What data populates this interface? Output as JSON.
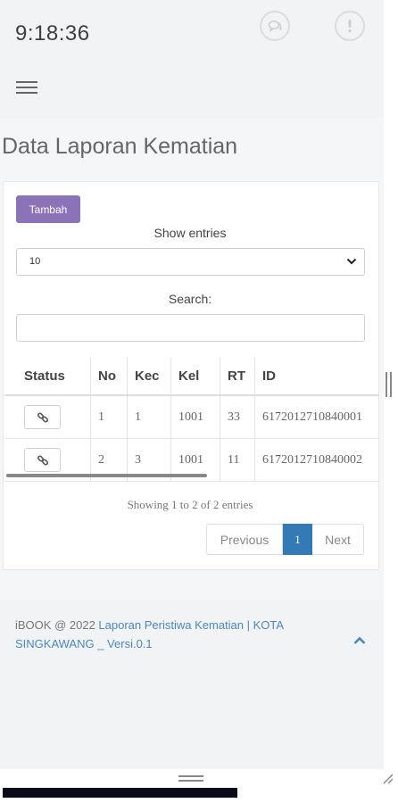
{
  "header": {
    "time": "9:18:36"
  },
  "page": {
    "title": "Data Laporan Kematian"
  },
  "actions": {
    "add_label": "Tambah"
  },
  "controls": {
    "show_entries_label": "Show entries",
    "entries_value": "10",
    "search_label": "Search:",
    "search_value": ""
  },
  "table": {
    "headers": [
      "Status",
      "No",
      "Kec",
      "Kel",
      "RT",
      "ID"
    ],
    "rows": [
      {
        "no": "1",
        "kec": "1",
        "kel": "1001",
        "rt": "33",
        "id": "6172012710840001"
      },
      {
        "no": "2",
        "kec": "3",
        "kel": "1001",
        "rt": "11",
        "id": "6172012710840002"
      }
    ]
  },
  "pagination": {
    "info": "Showing 1 to 2 of 2 entries",
    "previous": "Previous",
    "current": "1",
    "next": "Next"
  },
  "footer": {
    "prefix": "iBOOK @ 2022",
    "link_text": "Laporan Peristiwa Kematian | KOTA SINGKAWANG _ Versi.0.1"
  },
  "colors": {
    "accent": "#8a73b6",
    "primary": "#337ab7",
    "link": "#4a88c0"
  },
  "icons": [
    "chat-icon",
    "info-icon",
    "menu-icon",
    "link-icon",
    "chevron-down-icon",
    "chevron-up-icon"
  ]
}
